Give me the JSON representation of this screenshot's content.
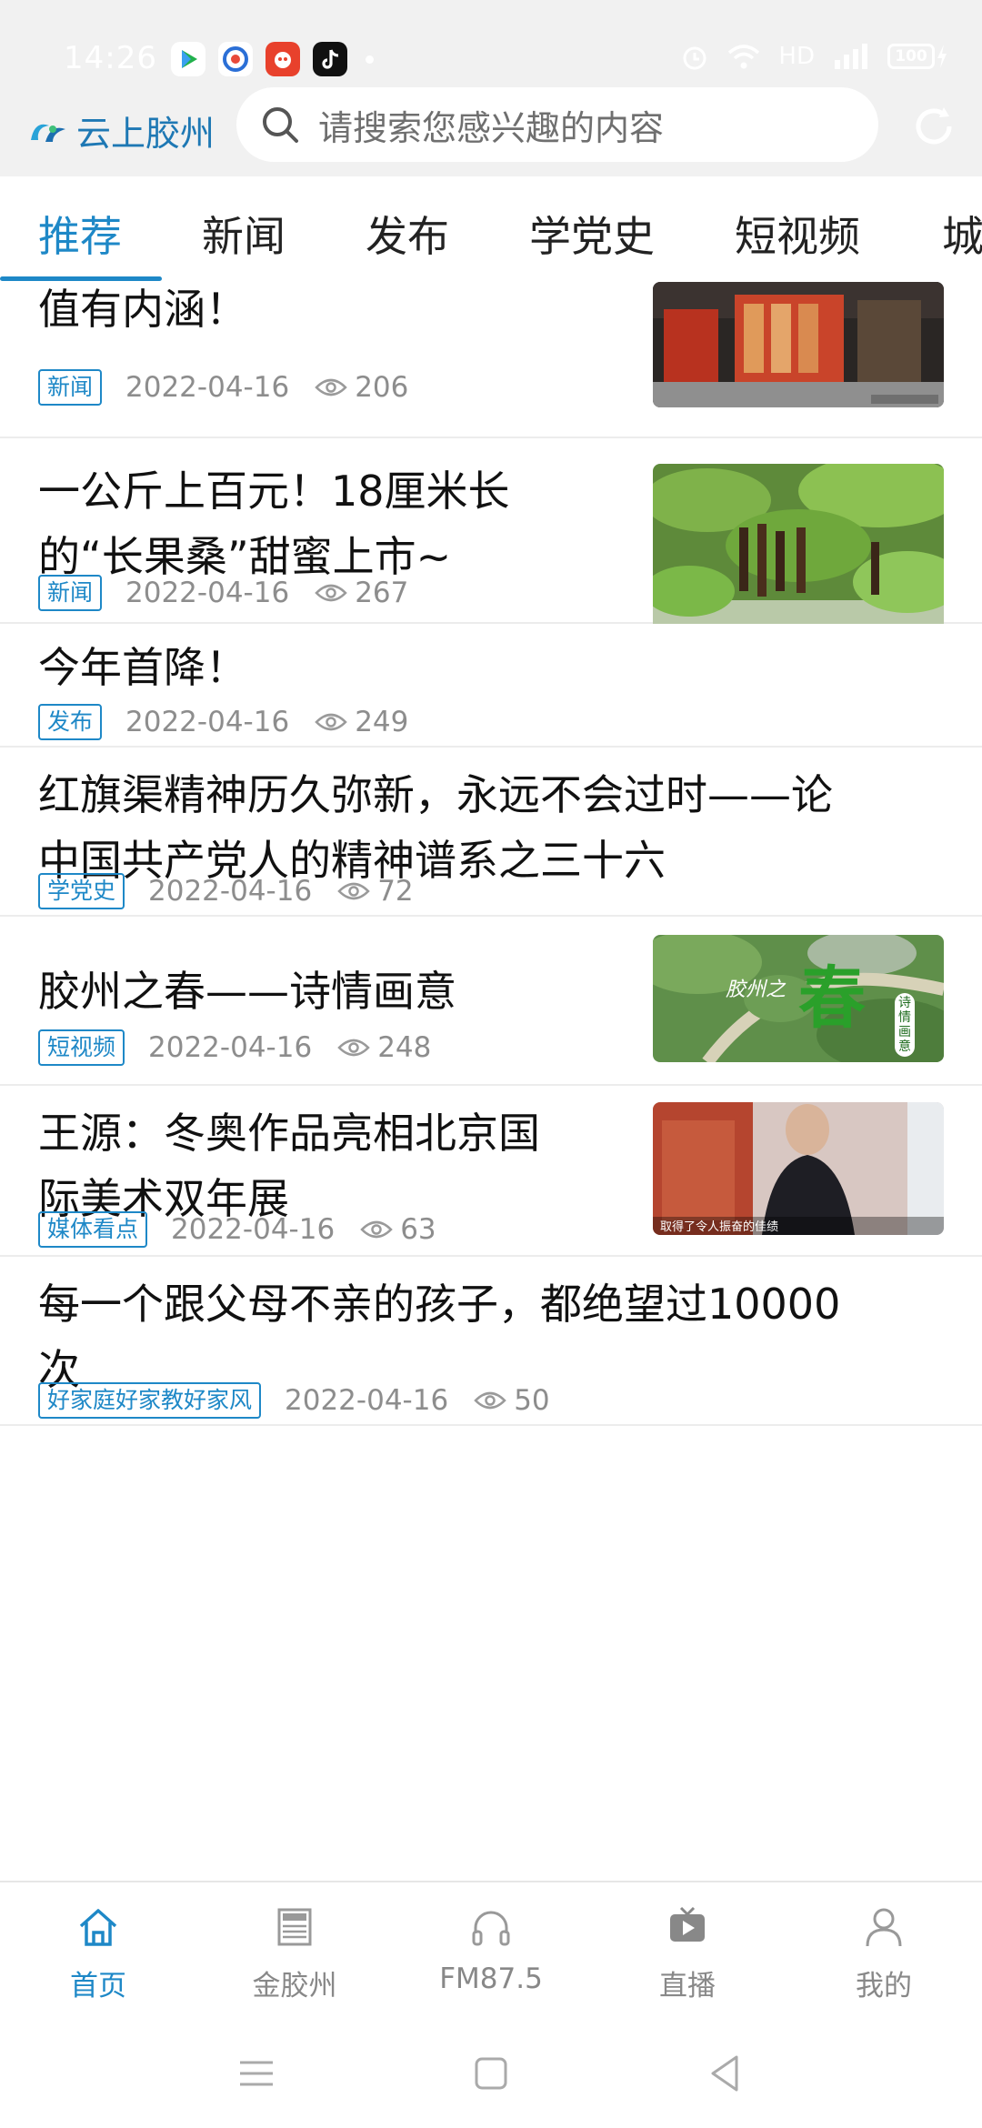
{
  "status_bar": {
    "time": "14:26",
    "network_label": "HD",
    "battery": "100"
  },
  "header": {
    "app_name": "云上胶州",
    "search_placeholder": "请搜索您感兴趣的内容"
  },
  "tabs": [
    {
      "label": "推荐",
      "active": true
    },
    {
      "label": "新闻"
    },
    {
      "label": "发布"
    },
    {
      "label": "学党史"
    },
    {
      "label": "短视频"
    },
    {
      "label": "城"
    }
  ],
  "feed": [
    {
      "title_lines": [
        "值有内涵！"
      ],
      "tag": "新闻",
      "date": "2022-04-16",
      "views": "206",
      "thumbnail": "museum-hall"
    },
    {
      "title_lines": [
        "一公斤上百元！18厘米长",
        "的“长果桑”甜蜜上市~"
      ],
      "tag": "新闻",
      "date": "2022-04-16",
      "views": "267",
      "thumbnail": "mulberry-tree"
    },
    {
      "title_lines": [
        "今年首降！"
      ],
      "tag": "发布",
      "date": "2022-04-16",
      "views": "249"
    },
    {
      "title_lines": [
        "红旗渠精神历久弥新，永远不会过时——论",
        "中国共产党人的精神谱系之三十六"
      ],
      "tag": "学党史",
      "date": "2022-04-16",
      "views": "72"
    },
    {
      "title_lines": [
        "胶州之春——诗情画意"
      ],
      "tag": "短视频",
      "date": "2022-04-16",
      "views": "248",
      "thumbnail": "spring-aerial",
      "thumb_caption": "胶州之",
      "thumb_big": "春",
      "thumb_sub": "诗情画意"
    },
    {
      "title_lines": [
        "王源：冬奥作品亮相北京国",
        "际美术双年展"
      ],
      "tag": "媒体看点",
      "date": "2022-04-16",
      "views": "63",
      "thumbnail": "interview-man",
      "thumb_caption": "取得了令人振奋的佳绩"
    },
    {
      "title_lines": [
        "每一个跟父母不亲的孩子，都绝望过10000",
        "次"
      ],
      "tag": "好家庭好家教好家风",
      "date": "2022-04-16",
      "views": "50"
    }
  ],
  "bottom_nav": [
    {
      "label": "首页",
      "icon": "home-icon",
      "active": true
    },
    {
      "label": "金胶州",
      "icon": "newspaper-icon"
    },
    {
      "label": "FM87.5",
      "icon": "headphones-icon"
    },
    {
      "label": "直播",
      "icon": "tv-icon"
    },
    {
      "label": "我的",
      "icon": "person-icon"
    }
  ],
  "colors": {
    "accent": "#1e88c7",
    "header_bg": "#f1f1f1",
    "muted_text": "#8d8d8d"
  }
}
